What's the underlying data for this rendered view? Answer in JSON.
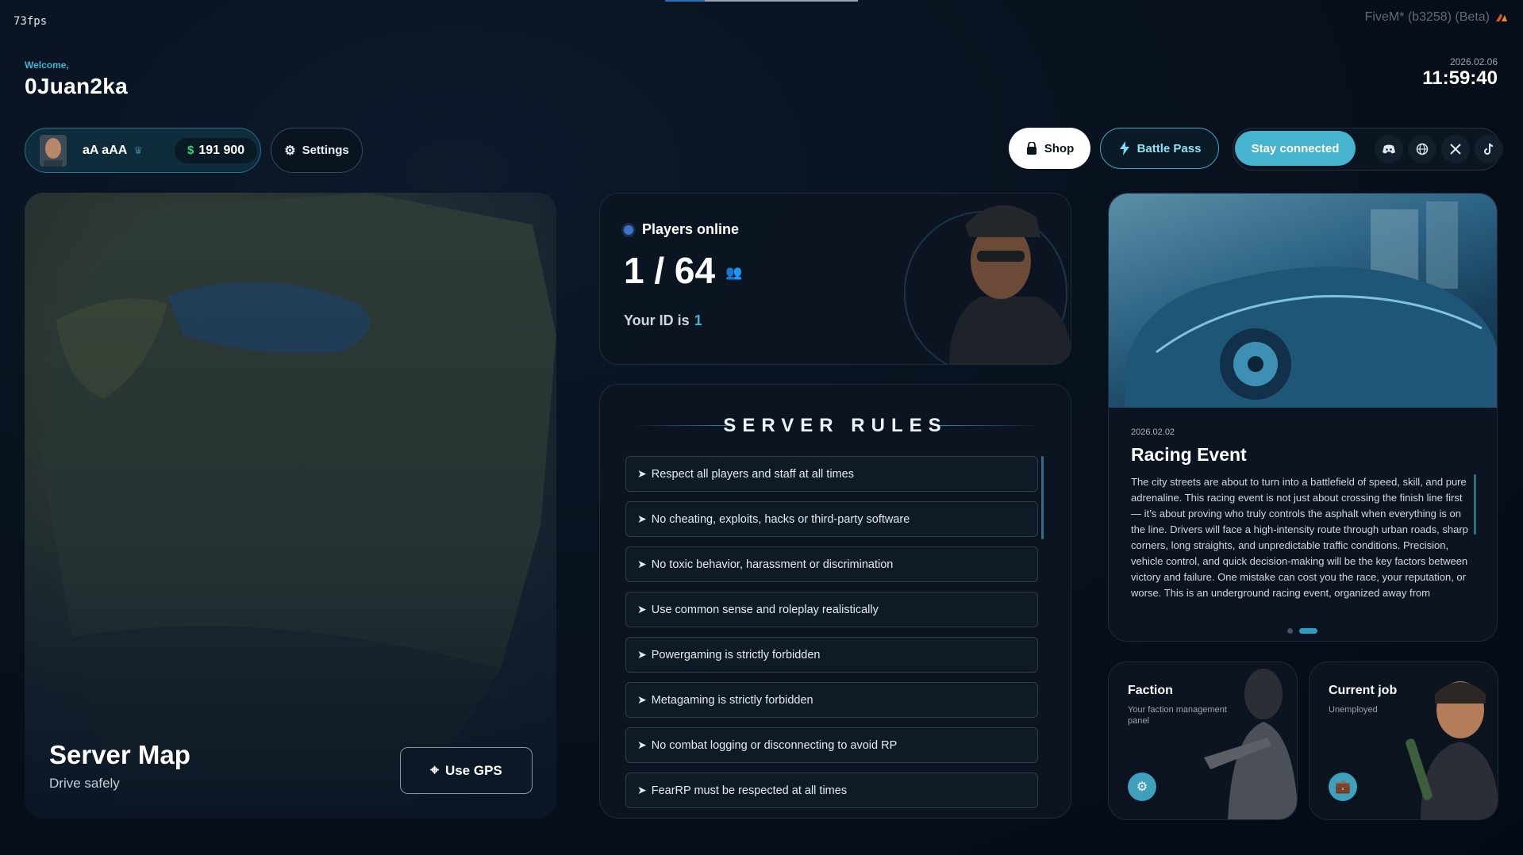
{
  "overlay": {
    "fps": "73fps",
    "build": "FiveM* (b3258) (Beta)"
  },
  "header": {
    "welcome": "Welcome,",
    "username": "0Juan2ka",
    "date": "2026.02.06",
    "time": "11:59:40"
  },
  "profile": {
    "name": "aA aAA",
    "money_symbol": "$",
    "money": "191 900",
    "settings_label": "Settings"
  },
  "actions": {
    "shop": "Shop",
    "battle_pass": "Battle Pass",
    "stay_connected": "Stay connected",
    "socials": [
      "discord-icon",
      "globe-icon",
      "x-icon",
      "tiktok-icon"
    ]
  },
  "map": {
    "title": "Server Map",
    "subtitle": "Drive safely",
    "gps_label": "Use GPS"
  },
  "players": {
    "label": "Players online",
    "count": "1 / 64",
    "your_id_label": "Your ID is",
    "your_id": "1"
  },
  "rules": {
    "title": "SERVER RULES",
    "items": [
      "Respect all players and staff at all times",
      "No cheating, exploits, hacks or third-party software",
      "No toxic behavior, harassment or discrimination",
      "Use common sense and roleplay realistically",
      "Powergaming is strictly forbidden",
      "Metagaming is strictly forbidden",
      "No combat logging or disconnecting to avoid RP",
      "FearRP must be respected at all times"
    ]
  },
  "event": {
    "date": "2026.02.02",
    "title": "Racing Event",
    "text": "The city streets are about to turn into a battlefield of speed, skill, and pure adrenaline. This racing event is not just about crossing the finish line first — it’s about proving who truly controls the asphalt when everything is on the line. Drivers will face a high-intensity route through urban roads, sharp corners, long straights, and unpredictable traffic conditions. Precision, vehicle control, and quick decision-making will be the key factors between victory and failure. One mistake can cost you the race, your reputation, or worse. This is an underground racing event, organized away from"
  },
  "faction": {
    "title": "Faction",
    "subtitle": "Your faction management panel"
  },
  "job": {
    "title": "Current job",
    "subtitle": "Unemployed"
  },
  "colors": {
    "accent": "#3fb4d2",
    "stay_connected": "#46b3cf",
    "money": "#3fd07a"
  }
}
